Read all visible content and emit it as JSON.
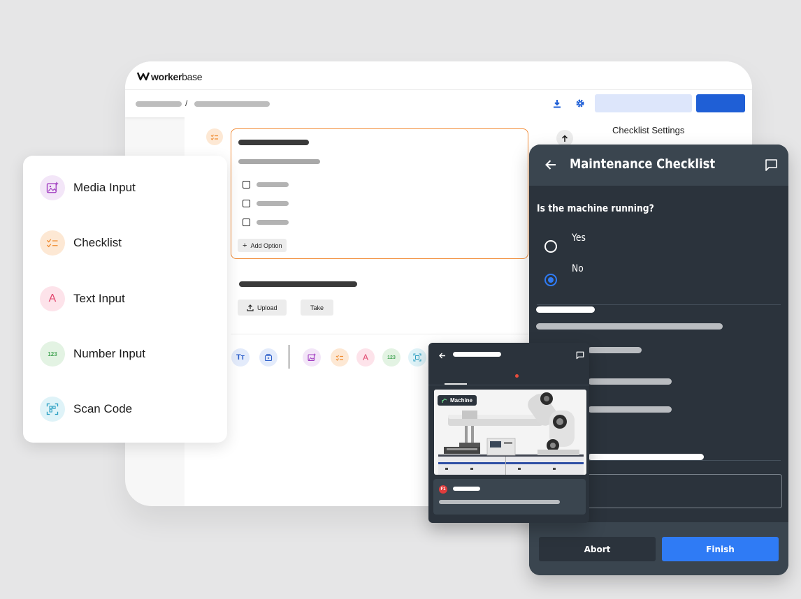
{
  "brand": {
    "name": "worker",
    "name_suffix": "base"
  },
  "editor": {
    "breadcrumb_separator": "/",
    "settings_title": "Checklist Settings",
    "add_option_label": "Add Option",
    "upload_label": "Upload",
    "take_label": "Take",
    "toolbar_icons": [
      "text-format-icon",
      "media-icon",
      "media-input-icon",
      "checklist-icon",
      "text-input-icon",
      "number-input-icon",
      "scan-code-icon"
    ]
  },
  "palette": {
    "items": [
      {
        "label": "Media Input",
        "icon": "media-input-icon"
      },
      {
        "label": "Checklist",
        "icon": "checklist-icon"
      },
      {
        "label": "Text Input",
        "icon": "text-input-icon"
      },
      {
        "label": "Number Input",
        "icon": "number-input-icon",
        "glyph": "123"
      },
      {
        "label": "Scan Code",
        "icon": "scan-code-icon"
      }
    ]
  },
  "mobile": {
    "title": "Maintenance Checklist",
    "question": "Is the machine running?",
    "options": [
      {
        "label": "Yes",
        "selected": false
      },
      {
        "label": "No",
        "selected": true
      }
    ],
    "abort_label": "Abort",
    "finish_label": "Finish"
  },
  "mini": {
    "machine_tag": "Machine",
    "step_badge": "F1"
  },
  "colors": {
    "accent_blue": "#2f7bf5",
    "dark_panel": "#2b333c",
    "orange_border": "#f28c38"
  }
}
